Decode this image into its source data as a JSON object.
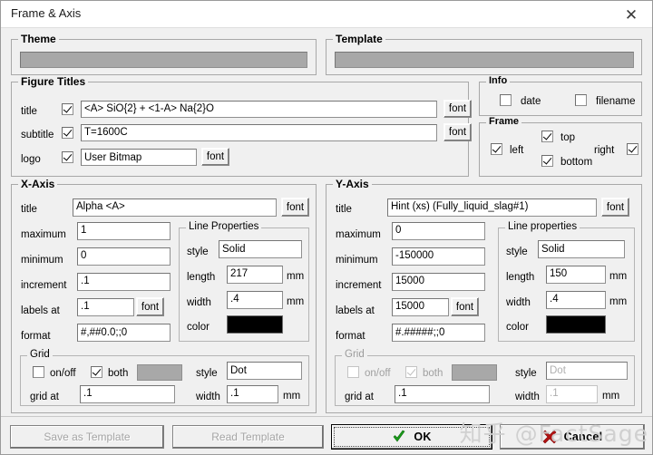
{
  "window": {
    "title": "Frame & Axis",
    "close_label": "✕"
  },
  "theme": {
    "legend": "Theme",
    "value": ""
  },
  "template": {
    "legend": "Template",
    "value": ""
  },
  "figure_titles": {
    "legend": "Figure Titles",
    "rows": [
      {
        "label": "title",
        "checked": true,
        "value": "<A> SiO{2}  + <1-A> Na{2}O",
        "font_label": "font"
      },
      {
        "label": "subtitle",
        "checked": true,
        "value": "T=1600C",
        "font_label": "font"
      }
    ],
    "logo": {
      "label": "logo",
      "checked": true,
      "value": "User Bitmap",
      "font_label": "font"
    }
  },
  "info": {
    "legend": "Info",
    "date": {
      "label": "date",
      "checked": false
    },
    "filename": {
      "label": "filename",
      "checked": false
    }
  },
  "frame": {
    "legend": "Frame",
    "left": {
      "label": "left",
      "checked": true
    },
    "top": {
      "label": "top",
      "checked": true
    },
    "right": {
      "label": "right",
      "checked": true
    },
    "bottom": {
      "label": "bottom",
      "checked": true
    }
  },
  "x_axis": {
    "legend": "X-Axis",
    "labels": {
      "title": "title",
      "maximum": "maximum",
      "minimum": "minimum",
      "increment": "increment",
      "labels_at": "labels at",
      "format": "format",
      "font": "font"
    },
    "title": "Alpha <A>",
    "maximum": "1",
    "minimum": "0",
    "increment": ".1",
    "labels_at": ".1",
    "format": "#,##0.0;;0",
    "line_properties": {
      "legend": "Line Properties",
      "labels": {
        "style": "style",
        "length": "length",
        "width": "width",
        "color": "color",
        "unit": "mm"
      },
      "style": "Solid",
      "length": "217",
      "width": ".4",
      "color": "#000000"
    },
    "grid": {
      "legend": "Grid",
      "labels": {
        "onoff": "on/off",
        "both": "both",
        "style": "style",
        "grid_at": "grid at",
        "width": "width",
        "unit": "mm"
      },
      "onoff_checked": false,
      "both_checked": true,
      "style": "Dot",
      "grid_at": ".1",
      "width": ".1",
      "swatch_color": "#a8a8a8",
      "disabled": false
    }
  },
  "y_axis": {
    "legend": "Y-Axis",
    "labels": {
      "title": "title",
      "maximum": "maximum",
      "minimum": "minimum",
      "increment": "increment",
      "labels_at": "labels at",
      "format": "format",
      "font": "font"
    },
    "title": "Hint (xs) (Fully_liquid_slag#1)",
    "maximum": "0",
    "minimum": "-150000",
    "increment": "15000",
    "labels_at": "15000",
    "format": "#.#####;;0",
    "line_properties": {
      "legend": "Line properties",
      "labels": {
        "style": "style",
        "length": "length",
        "width": "width",
        "color": "color",
        "unit": "mm"
      },
      "style": "Solid",
      "length": "150",
      "width": ".4",
      "color": "#000000"
    },
    "grid": {
      "legend": "Grid",
      "labels": {
        "onoff": "on/off",
        "both": "both",
        "style": "style",
        "grid_at": "grid at",
        "width": "width",
        "unit": "mm"
      },
      "onoff_checked": false,
      "both_checked": true,
      "style": "Dot",
      "grid_at": ".1",
      "width": ".1",
      "swatch_color": "#a8a8a8",
      "disabled": true
    }
  },
  "footer": {
    "save_template": "Save as Template",
    "read_template": "Read Template",
    "ok": "OK",
    "cancel": "Cancel"
  },
  "watermark": {
    "text": "知乎 @FactSage"
  }
}
